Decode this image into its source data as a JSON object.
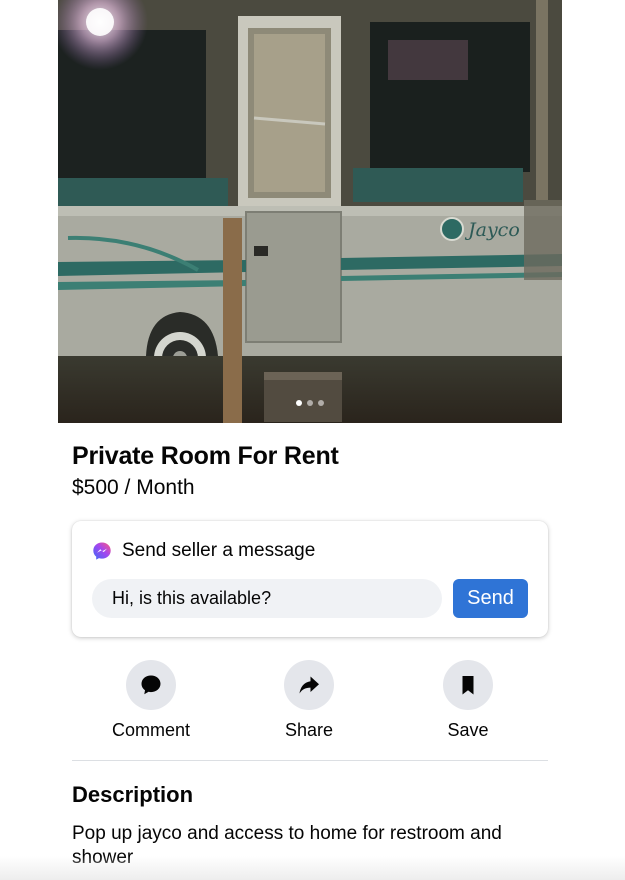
{
  "photo": {
    "alt": "Pop-up camper photo",
    "brand_mark": "Jayco",
    "slide_count": 3,
    "active_slide": 1
  },
  "listing": {
    "title": "Private Room For Rent",
    "price": "$500 / Month"
  },
  "message_card": {
    "title": "Send seller a message",
    "input_value": "Hi, is this available?",
    "send_label": "Send"
  },
  "actions": [
    {
      "label": "Comment",
      "icon": "comment-icon"
    },
    {
      "label": "Share",
      "icon": "share-icon"
    },
    {
      "label": "Save",
      "icon": "bookmark-icon"
    }
  ],
  "description": {
    "title": "Description",
    "text": "Pop up jayco and access to home for restroom and shower"
  },
  "colors": {
    "send_button": "#2f74d6",
    "input_background": "#f0f2f5",
    "action_circle": "#e4e6eb",
    "text": "#050505"
  }
}
